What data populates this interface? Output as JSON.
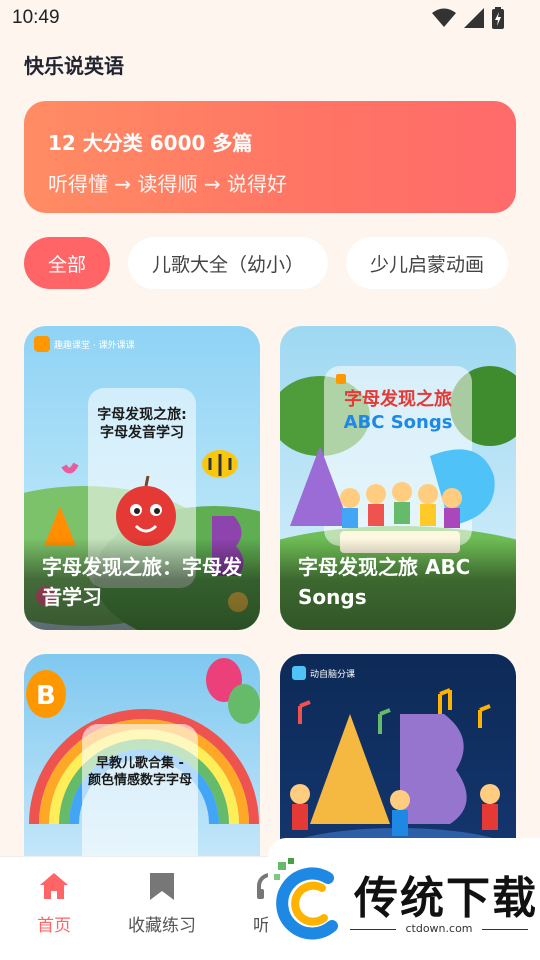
{
  "status": {
    "time": "10:49"
  },
  "app": {
    "title": "快乐说英语"
  },
  "banner": {
    "title": "12 大分类 6000 多篇",
    "subtitle": "听得懂 → 读得顺 → 说得好"
  },
  "categories": [
    {
      "label": "全部",
      "active": true
    },
    {
      "label": "儿歌大全（幼小）",
      "active": false
    },
    {
      "label": "少儿启蒙动画",
      "active": false
    }
  ],
  "cards": [
    {
      "title": "字母发现之旅：字母发音学习",
      "poster_brand": "趣趣课堂 · 课外课课",
      "poster_text": [
        "字母发现之旅:",
        "字母发音学习"
      ]
    },
    {
      "title": "字母发现之旅 ABC Songs",
      "poster_text": [
        "字母发现之旅",
        "ABC Songs"
      ]
    },
    {
      "title": "早教儿歌合集 - 颜色情感数字字母",
      "poster_text": [
        "早教儿歌合集 -",
        "颜色情感数字字母"
      ]
    },
    {
      "title": "",
      "poster_brand": "动自脑分课"
    }
  ],
  "nav": {
    "items": [
      {
        "label": "首页",
        "icon": "home-icon",
        "active": true
      },
      {
        "label": "收藏练习",
        "icon": "bookmark-icon",
        "active": false
      },
      {
        "label": "听读",
        "icon": "headphones-icon",
        "active": false
      }
    ]
  },
  "watermark": {
    "text": "传统下载",
    "url": "ctdown.com"
  },
  "colors": {
    "accent": "#ff6467",
    "background": "#fdf5ee"
  }
}
